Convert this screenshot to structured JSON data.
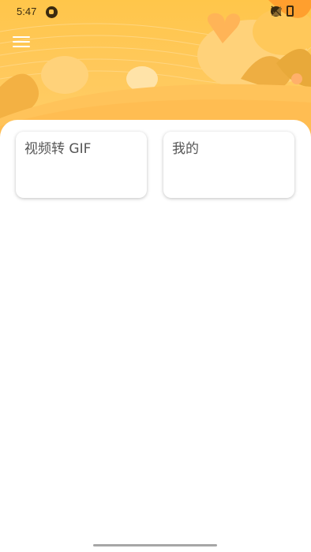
{
  "status_bar": {
    "time": "5:47",
    "icons": [
      "notification-icon",
      "dnd-icon",
      "notifications-off-icon",
      "wifi-icon",
      "signal-icon",
      "signal-icon",
      "battery-icon"
    ]
  },
  "header": {
    "menu_icon": "hamburger-menu-icon",
    "theme_colors": {
      "primary": "#ffc64a",
      "accent": "#ff9f2e",
      "leaf": "#e8a93a"
    }
  },
  "cards": [
    {
      "label": "视频转 GIF"
    },
    {
      "label": "我的"
    }
  ]
}
